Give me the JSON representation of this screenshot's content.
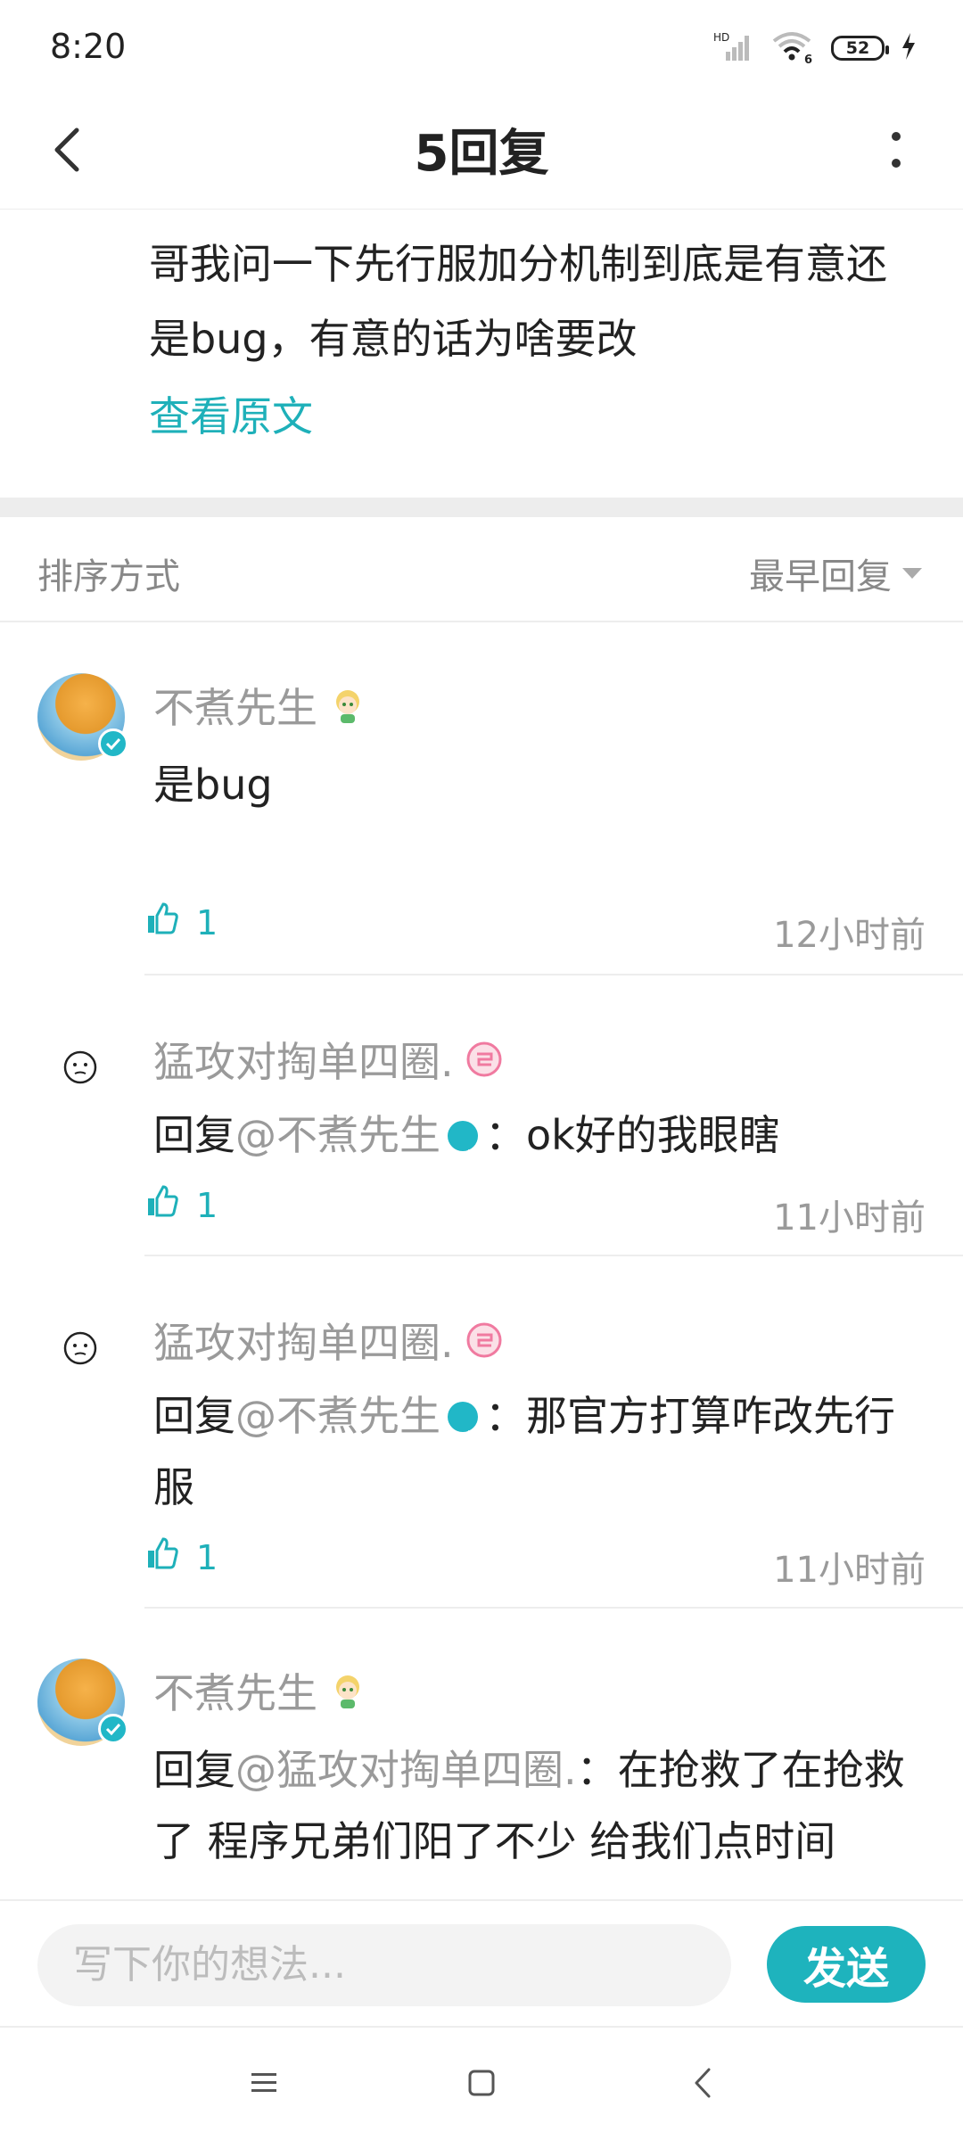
{
  "status": {
    "time": "8:20",
    "battery": "52",
    "signal": "HD",
    "wifi_label": "6"
  },
  "header": {
    "title": "5回复"
  },
  "original": {
    "text": "哥我问一下先行服加分机制到底是有意还是bug，有意的话为啥要改",
    "view_link": "查看原文"
  },
  "sort": {
    "label": "排序方式",
    "selected": "最早回复"
  },
  "replies": [
    {
      "user": "不煮先生",
      "content": "是bug",
      "likes": "1",
      "time": "12小时前"
    },
    {
      "user": "猛攻对掏单四圈.",
      "prefix": "回复",
      "mention": "@不煮先生",
      "text": "：ok好的我眼瞎",
      "likes": "1",
      "time": "11小时前"
    },
    {
      "user": "猛攻对掏单四圈.",
      "prefix": "回复",
      "mention": "@不煮先生",
      "text": "：那官方打算咋改先行服",
      "likes": "1",
      "time": "11小时前"
    },
    {
      "user": "不煮先生",
      "prefix": "回复",
      "mention": "@猛攻对掏单四圈.",
      "text": "：在抢救了在抢救了 程序兄弟们阳了不少 给我们点时间"
    }
  ],
  "input": {
    "placeholder": "写下你的想法...",
    "send_label": "发送"
  },
  "colors": {
    "accent": "#1eb3bd",
    "muted": "#9a9a9a"
  }
}
